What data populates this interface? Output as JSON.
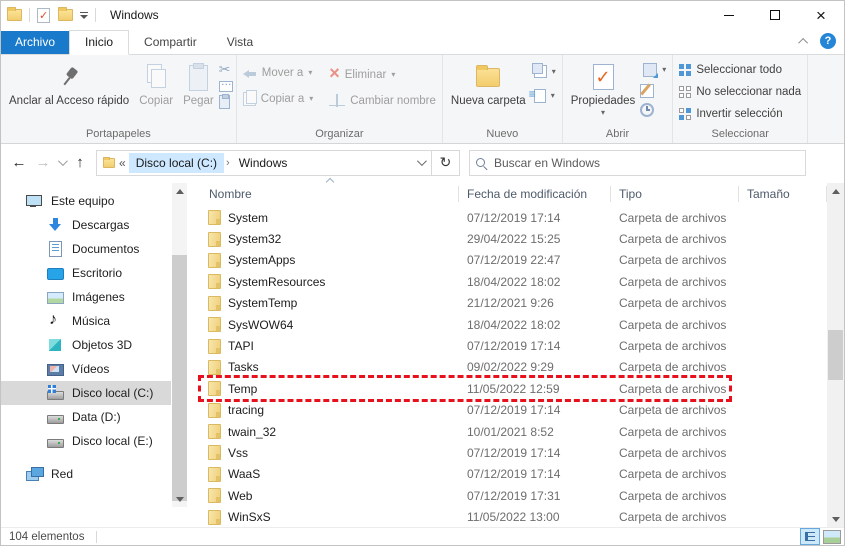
{
  "window": {
    "title": "Windows"
  },
  "tabs": {
    "file": "Archivo",
    "home": "Inicio",
    "share": "Compartir",
    "view": "Vista"
  },
  "ribbon": {
    "clipboard": {
      "group": "Portapapeles",
      "pin": "Anclar al Acceso rápido",
      "copy": "Copiar",
      "paste": "Pegar"
    },
    "organize": {
      "group": "Organizar",
      "move_to": "Mover a",
      "copy_to": "Copiar a",
      "delete": "Eliminar",
      "rename": "Cambiar nombre"
    },
    "new": {
      "group": "Nuevo",
      "new_folder": "Nueva carpeta"
    },
    "open": {
      "group": "Abrir",
      "properties": "Propiedades"
    },
    "select": {
      "group": "Seleccionar",
      "all": "Seleccionar todo",
      "none": "No seleccionar nada",
      "invert": "Invertir selección"
    }
  },
  "address": {
    "prefix": "«",
    "drive": "Disco local (C:)",
    "separator": "›",
    "folder": "Windows"
  },
  "search": {
    "placeholder": "Buscar en Windows"
  },
  "sidebar": {
    "items": [
      {
        "label": "Este equipo",
        "icon": "computer",
        "level": 0
      },
      {
        "label": "Descargas",
        "icon": "downloads",
        "level": 1
      },
      {
        "label": "Documentos",
        "icon": "documents",
        "level": 1
      },
      {
        "label": "Escritorio",
        "icon": "desktop",
        "level": 1
      },
      {
        "label": "Imágenes",
        "icon": "pictures",
        "level": 1
      },
      {
        "label": "Música",
        "icon": "music",
        "level": 1
      },
      {
        "label": "Objetos 3D",
        "icon": "objects3d",
        "level": 1
      },
      {
        "label": "Vídeos",
        "icon": "videos",
        "level": 1
      },
      {
        "label": "Disco local (C:)",
        "icon": "drive-windows",
        "level": 1,
        "selected": true
      },
      {
        "label": "Data (D:)",
        "icon": "drive",
        "level": 1
      },
      {
        "label": "Disco local (E:)",
        "icon": "drive",
        "level": 1
      },
      {
        "label": "Red",
        "icon": "network",
        "level": 0,
        "gap": true
      }
    ]
  },
  "filelist": {
    "columns": {
      "name": "Nombre",
      "modified": "Fecha de modificación",
      "type": "Tipo",
      "size": "Tamaño"
    },
    "rows": [
      {
        "name": "System",
        "modified": "07/12/2019 17:14",
        "type": "Carpeta de archivos",
        "size": ""
      },
      {
        "name": "System32",
        "modified": "29/04/2022 15:25",
        "type": "Carpeta de archivos",
        "size": ""
      },
      {
        "name": "SystemApps",
        "modified": "07/12/2019 22:47",
        "type": "Carpeta de archivos",
        "size": ""
      },
      {
        "name": "SystemResources",
        "modified": "18/04/2022 18:02",
        "type": "Carpeta de archivos",
        "size": ""
      },
      {
        "name": "SystemTemp",
        "modified": "21/12/2021 9:26",
        "type": "Carpeta de archivos",
        "size": ""
      },
      {
        "name": "SysWOW64",
        "modified": "18/04/2022 18:02",
        "type": "Carpeta de archivos",
        "size": ""
      },
      {
        "name": "TAPI",
        "modified": "07/12/2019 17:14",
        "type": "Carpeta de archivos",
        "size": ""
      },
      {
        "name": "Tasks",
        "modified": "09/02/2022 9:29",
        "type": "Carpeta de archivos",
        "size": ""
      },
      {
        "name": "Temp",
        "modified": "11/05/2022 12:59",
        "type": "Carpeta de archivos",
        "size": "",
        "highlighted": true
      },
      {
        "name": "tracing",
        "modified": "07/12/2019 17:14",
        "type": "Carpeta de archivos",
        "size": ""
      },
      {
        "name": "twain_32",
        "modified": "10/01/2021 8:52",
        "type": "Carpeta de archivos",
        "size": ""
      },
      {
        "name": "Vss",
        "modified": "07/12/2019 17:14",
        "type": "Carpeta de archivos",
        "size": ""
      },
      {
        "name": "WaaS",
        "modified": "07/12/2019 17:14",
        "type": "Carpeta de archivos",
        "size": ""
      },
      {
        "name": "Web",
        "modified": "07/12/2019 17:31",
        "type": "Carpeta de archivos",
        "size": ""
      },
      {
        "name": "WinSxS",
        "modified": "11/05/2022 13:00",
        "type": "Carpeta de archivos",
        "size": ""
      }
    ]
  },
  "statusbar": {
    "count": "104 elementos"
  },
  "colors": {
    "accent_blue": "#1979ca",
    "highlight_red": "#e8101c",
    "crumb_highlight": "#cde8ff",
    "selected_gray": "#d9d9d9"
  }
}
